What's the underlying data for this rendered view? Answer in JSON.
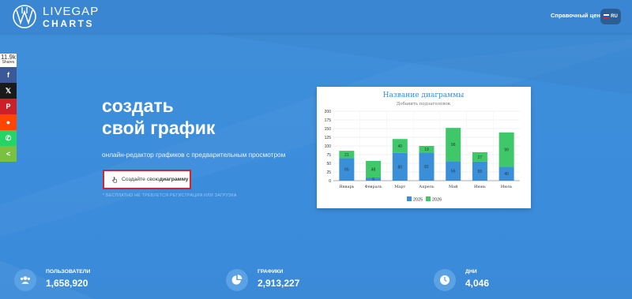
{
  "brand": {
    "line1": "LIVEGAP",
    "line2": "CHARTS"
  },
  "header": {
    "help_link": "Справочный центр",
    "lang_code": "RU"
  },
  "share": {
    "count": "11.9k",
    "label": "Shares",
    "buttons": [
      {
        "icon": "facebook-icon",
        "glyph": "f",
        "color": "#3b5998"
      },
      {
        "icon": "x-icon",
        "glyph": "𝕏",
        "color": "#1a1a1a"
      },
      {
        "icon": "pinterest-icon",
        "glyph": "P",
        "color": "#cb2027"
      },
      {
        "icon": "reddit-icon",
        "glyph": "●",
        "color": "#ff4500"
      },
      {
        "icon": "whatsapp-icon",
        "glyph": "✆",
        "color": "#25d366"
      },
      {
        "icon": "share-icon",
        "glyph": "<",
        "color": "#7ac143"
      }
    ]
  },
  "hero": {
    "title_line1": "создать",
    "title_line2": "свой график",
    "subtitle": "онлайн-редактор графиков с предварительным просмотром",
    "cta_prefix": "Создайте свою ",
    "cta_bold": "диаграмму",
    "note": "* БЕСПЛАТНО НЕ ТРЕБУЕТСЯ РЕГИСТРАЦИЯ ИЛИ ЗАГРУЗКА"
  },
  "chart_data": {
    "type": "bar",
    "stacked": true,
    "title": "Название диаграммы",
    "subtitle": "Добавить подзаголовок",
    "categories": [
      "Январь",
      "Февраль",
      "Март",
      "Апрель",
      "Май",
      "Июнь",
      "Июль"
    ],
    "series": [
      {
        "name": "2025",
        "values": [
          65,
          9,
          80,
          81,
          56,
          55,
          40
        ],
        "color": "#3a8fd9"
      },
      {
        "name": "2026",
        "values": [
          21,
          48,
          40,
          19,
          96,
          27,
          99
        ],
        "color": "#3ec86a"
      }
    ],
    "ylim": [
      0,
      200
    ],
    "yticks": [
      0,
      25,
      50,
      75,
      100,
      125,
      150,
      175,
      200
    ],
    "grid": true,
    "legend": "bottom"
  },
  "stats": [
    {
      "label": "ПОЛЬЗОВАТЕЛИ",
      "value": "1,658,920",
      "icon": "users-icon"
    },
    {
      "label": "ГРАФИКИ",
      "value": "2,913,227",
      "icon": "pie-chart-icon"
    },
    {
      "label": "ДНИ",
      "value": "4,046",
      "icon": "clock-icon"
    }
  ],
  "colors": {
    "accent": "#3b86d2",
    "cta_border": "#d2262c"
  }
}
